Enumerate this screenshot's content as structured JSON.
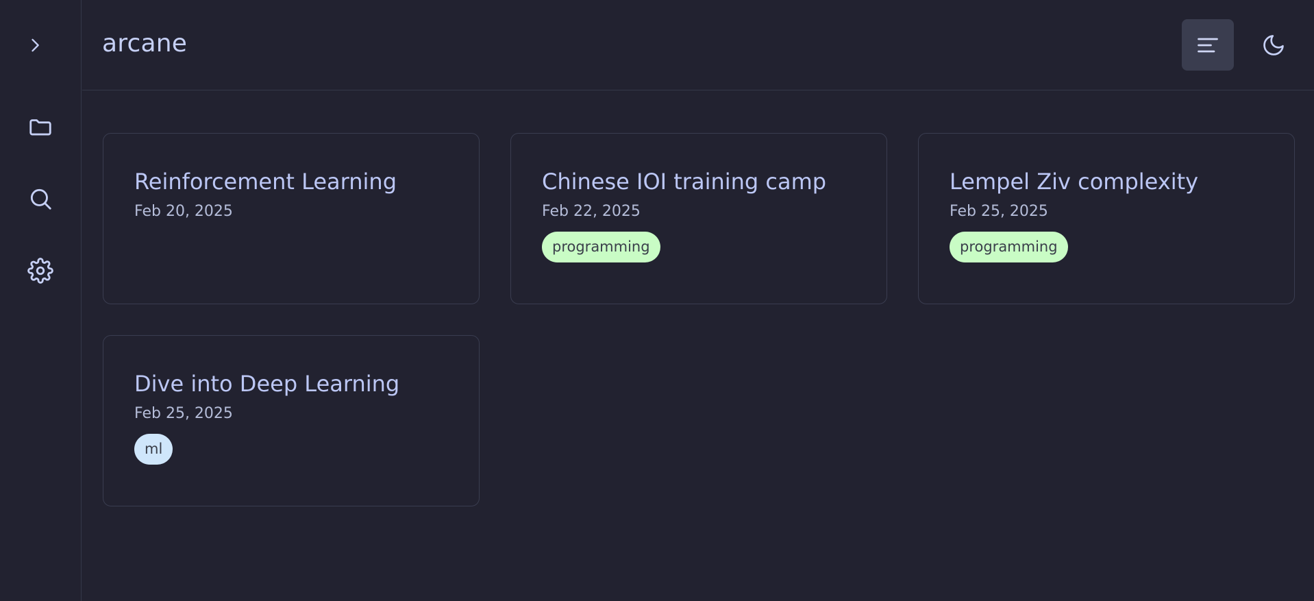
{
  "app": {
    "title": "arcane"
  },
  "sidebar": {
    "items": [
      {
        "name": "expand",
        "icon": "chevron-right-icon"
      },
      {
        "name": "files",
        "icon": "folder-icon"
      },
      {
        "name": "search",
        "icon": "search-icon"
      },
      {
        "name": "settings",
        "icon": "gear-icon"
      }
    ]
  },
  "header": {
    "toc_icon": "menu-lines-icon",
    "theme_icon": "moon-icon"
  },
  "colors": {
    "background": "#222230",
    "border": "#353849",
    "text": "#c6d0f5",
    "tag_green": "#c9fcc5",
    "tag_blue": "#cfe6fb",
    "button_active": "#3a3d4f"
  },
  "cards": [
    {
      "title": "Reinforcement Learning",
      "date": "Feb 20, 2025",
      "tags": []
    },
    {
      "title": "Chinese IOI training camp",
      "date": "Feb 22, 2025",
      "tags": [
        "programming"
      ]
    },
    {
      "title": "Lempel Ziv complexity",
      "date": "Feb 25, 2025",
      "tags": [
        "programming"
      ]
    },
    {
      "title": "Dive into Deep Learning",
      "date": "Feb 25, 2025",
      "tags": [
        "ml"
      ]
    }
  ]
}
